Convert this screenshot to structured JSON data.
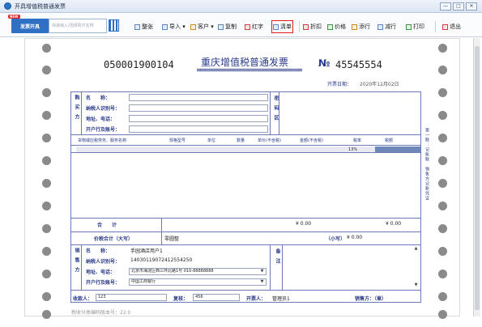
{
  "window": {
    "title": "开具增值税普通发票",
    "buttons": [
      "—",
      "□",
      "✕"
    ]
  },
  "toolbar": {
    "issue_label": "发票开具",
    "issue_badge": "NEW",
    "quick_search_placeholder": "快速输入/选择购方名称",
    "buttons": [
      "整张",
      "导入",
      "客户",
      "复制",
      "红字",
      "清单",
      "折扣",
      "价格",
      "添行",
      "减行",
      "打印",
      "退出"
    ]
  },
  "invoice": {
    "code": "050001900104",
    "title": "重庆增值税普通发票",
    "no_label": "№",
    "number": "45545554",
    "date_label": "开票日期：",
    "date_value": "2020年12月02日",
    "buyer": {
      "side_label": "购买方",
      "name_label": "名　　称：",
      "tax_label": "纳税人识别号：",
      "addr_label": "地址、电话：",
      "bank_label": "开户行及账号："
    },
    "password_label": "密码区",
    "columns": [
      "货物或应税劳务、服务名称",
      "规格型号",
      "单位",
      "数量",
      "单价(不含税)",
      "金额(不含税)",
      "税率",
      "税额"
    ],
    "rate_value": "13%",
    "side_caption": "第一联：记账联　销售方记账凭证",
    "total_label": "合　　计",
    "total_amount": "¥ 0.00",
    "total_tax": "¥ 0.00",
    "grand_label": "价税合计（大写）",
    "grand_upper": "零圆整",
    "grand_lower_label": "（小写）",
    "grand_lower": "¥ 0.00",
    "seller": {
      "side_label": "销售方",
      "name_label": "名　　称：",
      "name_value": "手园酒店用户1",
      "tax_label": "纳税人识别号：",
      "tax_value": "14030119072412554250",
      "addr_label": "地址、电话：",
      "addr_value": "北京市海淀区西三环北路1号 010-88888888",
      "bank_label": "开户行及账号：",
      "bank_value": "中国工商银行"
    },
    "remark_label": "备注",
    "payee_label": "收款人：",
    "payee_value": "123",
    "checker_label": "复核：",
    "checker_value": "456",
    "drawer_label": "开票人：",
    "drawer_value": "管理员1",
    "seller_sign_label": "销售方：（章）",
    "footer_note": "税收分类编码版本号：22.0"
  },
  "colors": {
    "accent": "#2f6fc4",
    "form_blue": "#2a3a8a",
    "highlight": "#e31b1b"
  }
}
